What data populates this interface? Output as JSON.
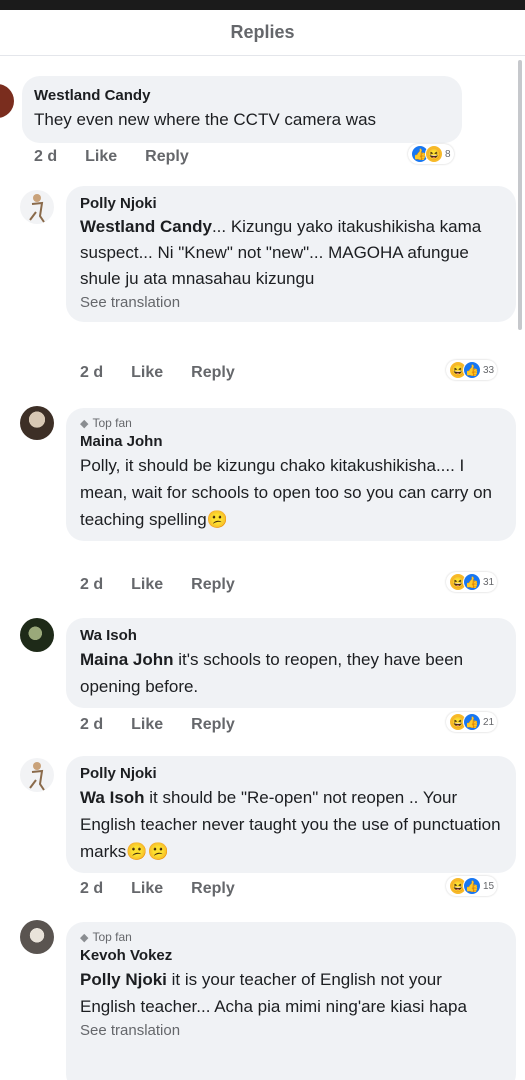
{
  "header": {
    "title": "Replies"
  },
  "comments": [
    {
      "author": "Westland Candy",
      "top_fan": false,
      "mention": "",
      "text": "They even new where the CCTV camera was",
      "see_translation": "",
      "time": "2 d",
      "like": "Like",
      "reply": "Reply",
      "reactions": [
        "like",
        "haha"
      ],
      "reaction_count": "8"
    },
    {
      "author": "Polly Njoki",
      "top_fan": false,
      "mention": "Westland Candy",
      "text": "... Kizungu yako itakushikisha kama suspect... Ni \"Knew\" not \"new\"... MAGOHA  afungue shule ju ata mnasahau kizungu",
      "see_translation": "See translation",
      "time": "2 d",
      "like": "Like",
      "reply": "Reply",
      "reactions": [
        "haha",
        "like"
      ],
      "reaction_count": "33"
    },
    {
      "author": "Maina John",
      "top_fan": true,
      "top_fan_label": "Top fan",
      "mention": "",
      "text": "Polly, it should be kizungu chako kitakushikisha.... I mean, wait for schools to open too so you can carry on teaching spelling😕",
      "see_translation": "",
      "time": "2 d",
      "like": "Like",
      "reply": "Reply",
      "reactions": [
        "haha",
        "like"
      ],
      "reaction_count": "31"
    },
    {
      "author": "Wa Isoh",
      "top_fan": false,
      "mention": "Maina John",
      "text": " it's schools to reopen, they have been opening before.",
      "see_translation": "",
      "time": "2 d",
      "like": "Like",
      "reply": "Reply",
      "reactions": [
        "haha",
        "like"
      ],
      "reaction_count": "21"
    },
    {
      "author": "Polly Njoki",
      "top_fan": false,
      "mention": "Wa Isoh",
      "text": " it should be \"Re-open\"  not reopen .. Your English teacher never taught you the use of punctuation marks😕😕",
      "see_translation": "",
      "time": "2 d",
      "like": "Like",
      "reply": "Reply",
      "reactions": [
        "haha",
        "like"
      ],
      "reaction_count": "15"
    },
    {
      "author": "Kevoh Vokez",
      "top_fan": true,
      "top_fan_label": "Top fan",
      "mention": "Polly Njoki",
      "text": " it is your teacher of English not your English teacher... Acha pia mimi ning'are kiasi hapa",
      "see_translation": "See translation",
      "time": "",
      "like": "",
      "reply": "",
      "reactions": [],
      "reaction_count": ""
    }
  ],
  "colors": {
    "bubble": "#f0f2f5",
    "like_blue": "#1877f2",
    "haha_yellow": "#f7b928",
    "meta_gray": "#65676b"
  }
}
